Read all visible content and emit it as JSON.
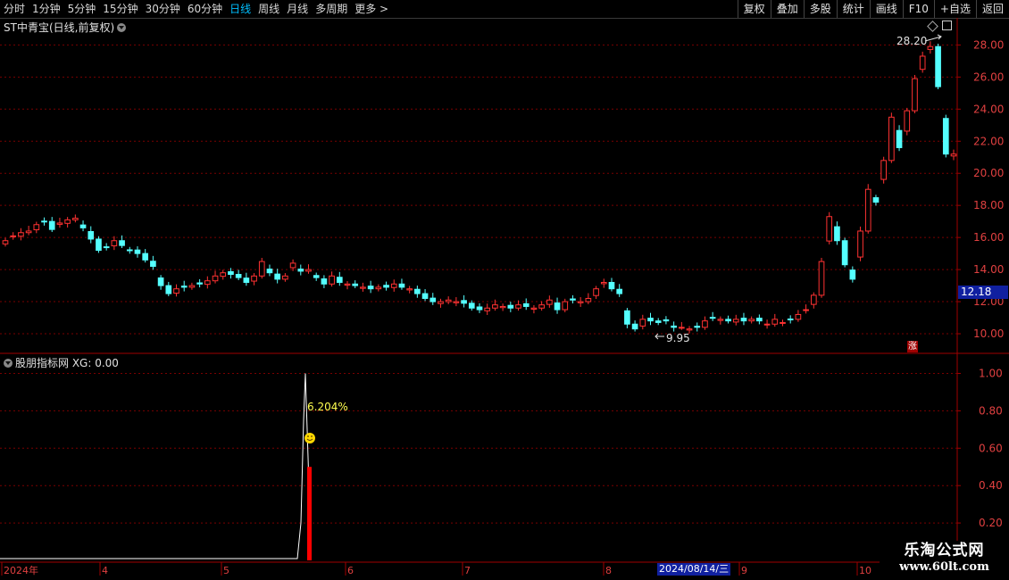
{
  "toolbar": {
    "periods": [
      "分时",
      "1分钟",
      "5分钟",
      "15分钟",
      "30分钟",
      "60分钟",
      "日线",
      "周线",
      "月线",
      "多周期",
      "更多"
    ],
    "active_period": "日线",
    "buttons": [
      "复权",
      "叠加",
      "多股",
      "统计",
      "画线",
      "F10",
      "+自选",
      "返回"
    ],
    "more_arrow": ">"
  },
  "main_title": "ST中青宝(日线,前复权)",
  "indicator_title": "股朋指标网 XG: 0.00",
  "current_price_tag": "12.18",
  "zhang_badge": "涨",
  "high_annotation": "28.20",
  "low_annotation": "9.95",
  "spike_annotation": "6.204%",
  "date_tag": "2024/08/14/三",
  "watermark": {
    "title": "乐淘公式网",
    "url": "www.60lt.com"
  },
  "colors": {
    "up": "#ff3232",
    "down": "#54ffff",
    "grid": "#7a0000",
    "axis_text": "#e04040",
    "panel_border": "#a00000",
    "active": "#00bfff",
    "price_tag_bg": "#1020a0",
    "signal_bar": "#ff0000",
    "annotation_yellow": "#ffff50"
  },
  "chart_data": {
    "type": "candlestick",
    "main_panel": {
      "y_ticks": [
        "28.00",
        "26.00",
        "24.00",
        "22.00",
        "20.00",
        "18.00",
        "16.00",
        "14.00",
        "12.00",
        "10.00"
      ],
      "ylim": [
        9.0,
        28.8
      ],
      "close_series_approx": [
        15.8,
        16.1,
        16.3,
        16.4,
        16.8,
        17.0,
        16.5,
        16.9,
        17.1,
        17.2,
        16.6,
        15.9,
        15.2,
        15.4,
        15.8,
        15.5,
        15.2,
        15.0,
        14.6,
        14.2,
        13.0,
        12.5,
        12.8,
        12.9,
        13.0,
        13.1,
        13.3,
        13.6,
        13.8,
        13.7,
        13.5,
        13.2,
        13.6,
        14.5,
        13.8,
        13.4,
        13.6,
        14.4,
        13.9,
        14.0,
        13.5,
        13.1,
        13.6,
        13.2,
        13.1,
        13.0,
        12.9,
        12.8,
        12.9,
        12.9,
        13.1,
        12.9,
        12.8,
        12.5,
        12.2,
        12.0,
        12.0,
        12.1,
        12.0,
        11.9,
        11.6,
        11.5,
        11.6,
        11.8,
        11.7,
        11.6,
        11.8,
        11.7,
        11.6,
        11.8,
        12.1,
        11.5,
        12.0,
        12.1,
        12.0,
        12.2,
        12.8,
        13.2,
        12.8,
        12.5,
        10.6,
        10.3,
        10.9,
        10.8,
        10.7,
        10.8,
        10.4,
        10.4,
        10.3,
        10.4,
        10.8,
        11.0,
        10.9,
        10.8,
        10.9,
        10.8,
        10.9,
        10.8,
        10.6,
        10.9,
        10.7,
        10.9,
        11.2,
        11.5,
        12.4,
        14.5,
        17.3,
        15.8,
        14.3,
        13.4,
        16.4,
        19.0,
        18.2,
        20.8,
        23.5,
        21.6,
        23.9,
        25.9,
        27.3,
        27.9,
        25.4,
        21.2,
        21.2
      ],
      "low_label": "9.95",
      "high_label": "28.20",
      "current_price": "12.18"
    },
    "indicator_panel": {
      "name": "XG",
      "y_ticks": [
        "1.00",
        "0.80",
        "0.60",
        "0.40",
        "0.20"
      ],
      "ylim": [
        0,
        1.05
      ],
      "signal_bar_value": 0.5,
      "line_peak_value": 1.0,
      "annotation": "6.204%"
    },
    "x_ticks": [
      "2024年",
      "4",
      "5",
      "6",
      "7",
      "8",
      "9",
      "10"
    ]
  }
}
